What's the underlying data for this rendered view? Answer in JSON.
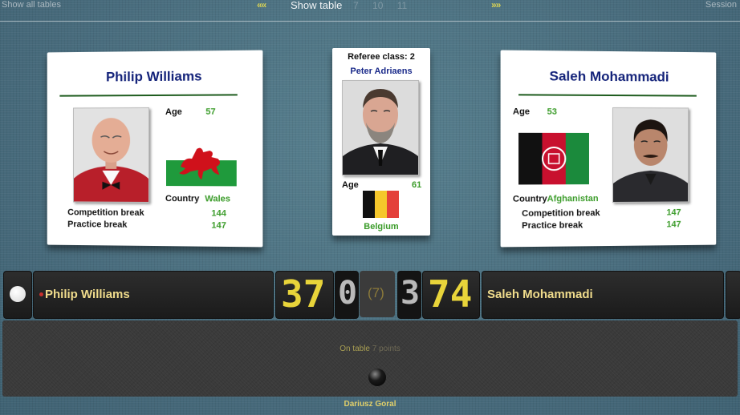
{
  "topbar": {
    "show_all_tables": "Show all tables",
    "prev_icon": "double-chevron-left-icon",
    "show_table": "Show table",
    "table_numbers": [
      "7",
      "10",
      "11"
    ],
    "next_icon": "double-chevron-right-icon",
    "session": "Session"
  },
  "player1": {
    "name": "Philip Williams",
    "age_label": "Age",
    "age": "57",
    "country_label": "Country",
    "country": "Wales",
    "competition_break_label": "Competition break",
    "competition_break": "144",
    "practice_break_label": "Practice break",
    "practice_break": "147"
  },
  "referee": {
    "class_label": "Referee class: 2",
    "name": "Peter Adriaens",
    "age_label": "Age",
    "age": "61",
    "country": "Belgium"
  },
  "player2": {
    "name": "Saleh Mohammadi",
    "age_label": "Age",
    "age": "53",
    "country_label": "Country",
    "country": "Afghanistan",
    "competition_break_label": "Competition break",
    "competition_break": "147",
    "practice_break_label": "Practice break",
    "practice_break": "147"
  },
  "scoreboard": {
    "p1_name": "Philip Williams",
    "p1_score": "37",
    "p1_frames": "0",
    "best_of": "(7)",
    "p2_frames": "3",
    "p2_score": "74",
    "p2_name": "Saleh Mohammadi"
  },
  "table_info": {
    "on_table_label": "On table",
    "on_table_value": "7 points",
    "commentator": "Dariusz Goral"
  },
  "colors": {
    "accent_yellow": "#e8d43a",
    "name_blue": "#14237a",
    "value_green": "#3b9c2a"
  }
}
